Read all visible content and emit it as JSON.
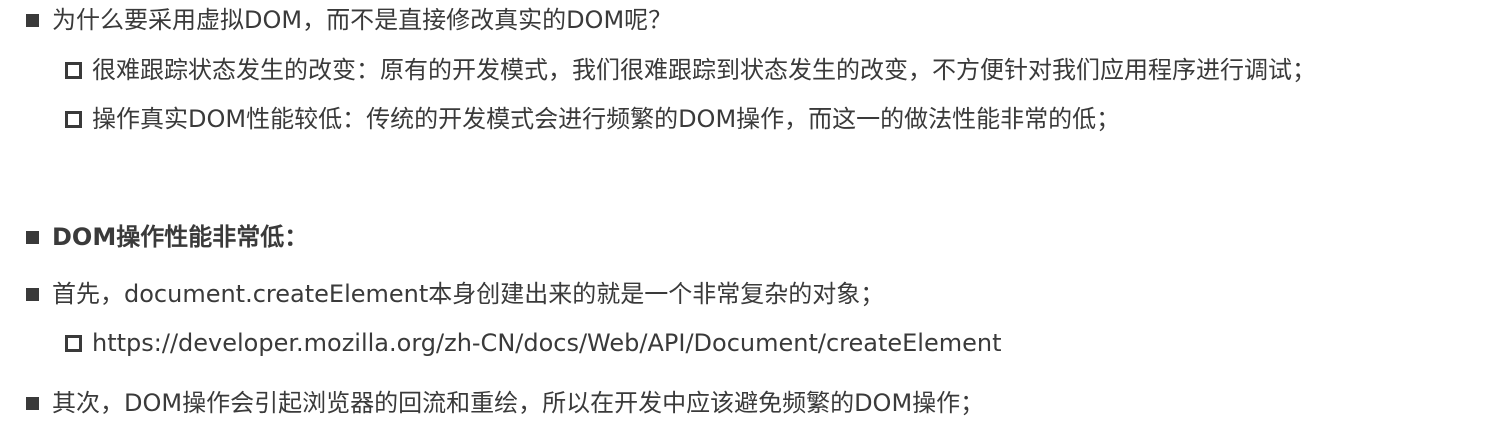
{
  "section1": {
    "heading": "为什么要采用虚拟DOM，而不是直接修改真实的DOM呢？",
    "sub_items": [
      "很难跟踪状态发生的改变：原有的开发模式，我们很难跟踪到状态发生的改变，不方便针对我们应用程序进行调试；",
      "操作真实DOM性能较低：传统的开发模式会进行频繁的DOM操作，而这一的做法性能非常的低；"
    ]
  },
  "section2": {
    "heading": "DOM操作性能非常低：",
    "item1": "首先，document.createElement本身创建出来的就是一个非常复杂的对象；",
    "item1_link": "https://developer.mozilla.org/zh-CN/docs/Web/API/Document/createElement",
    "item2": "其次，DOM操作会引起浏览器的回流和重绘，所以在开发中应该避免频繁的DOM操作；"
  }
}
